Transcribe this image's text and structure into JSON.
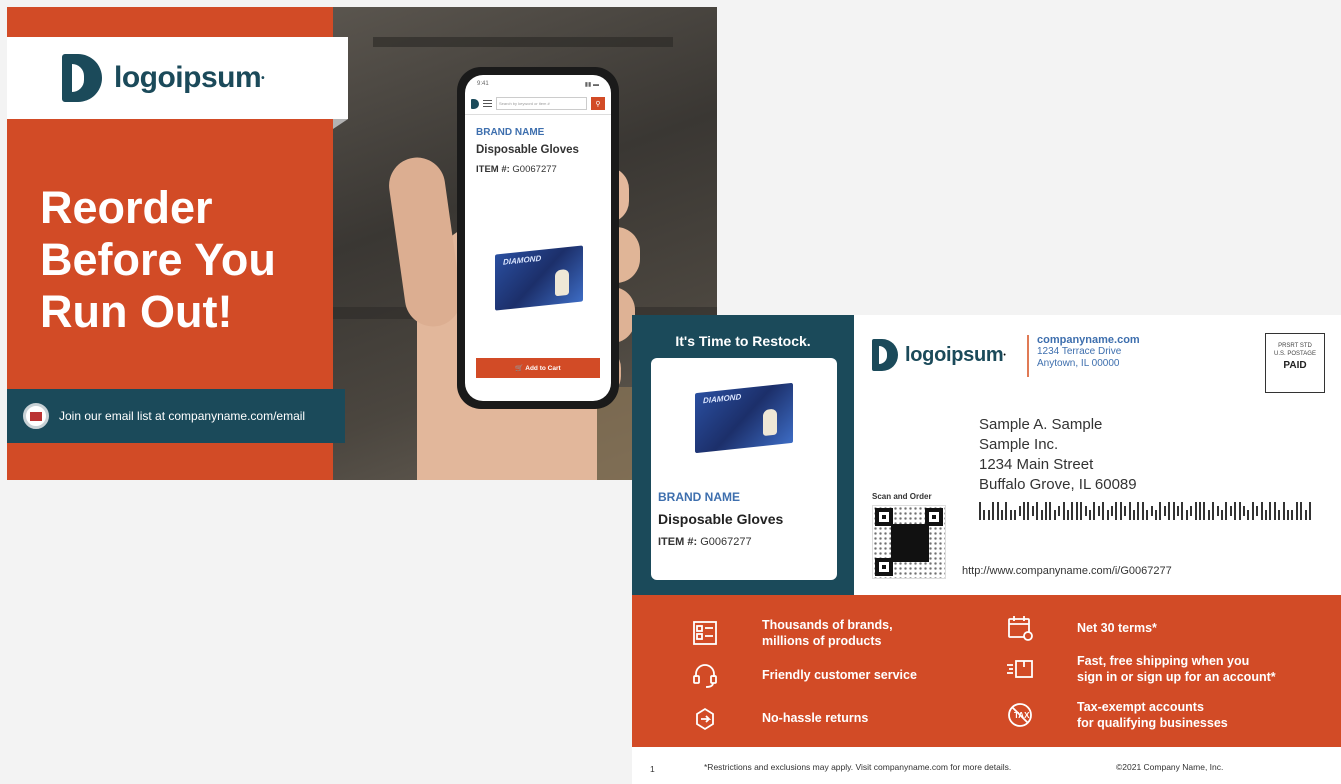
{
  "front": {
    "logo_text": "logoipsum",
    "headline": "Reorder Before You Run Out!",
    "email_bar": "Join our email list at companyname.com/email",
    "phone": {
      "status_time": "9:41",
      "status_icons": "▮▮ ▬",
      "search_placeholder": "Search by keyword or item #",
      "brand": "BRAND NAME",
      "product": "Disposable Gloves",
      "item_label": "ITEM #:",
      "item_number": "G0067277",
      "product_box_text": "DIAMOND",
      "cart_button": "Add to Cart"
    }
  },
  "back": {
    "restock_heading": "It's Time to Restock.",
    "brand": "BRAND NAME",
    "product": "Disposable Gloves",
    "item_label": "ITEM #:",
    "item_number": "G0067277",
    "product_box_text": "DIAMOND",
    "logo_text": "logoipsum",
    "company": {
      "url": "companyname.com",
      "street": "1234 Terrace Drive",
      "city": "Anytown, IL 00000"
    },
    "postage": {
      "line1": "PRSRT STD",
      "line2": "U.S. POSTAGE",
      "paid": "PAID"
    },
    "address": {
      "name": "Sample A. Sample",
      "company": "Sample Inc.",
      "street": "1234 Main Street",
      "city": "Buffalo Grove, IL  60089"
    },
    "scan_label": "Scan and Order",
    "reorder_link": "http://www.companyname.com/i/G0067277",
    "benefits": [
      {
        "icon": "catalog-icon",
        "text": "Thousands of brands,\nmillions of products"
      },
      {
        "icon": "headset-icon",
        "text": "Friendly customer service"
      },
      {
        "icon": "return-box-icon",
        "text": "No-hassle returns"
      },
      {
        "icon": "calendar-icon",
        "text": "Net 30 terms*"
      },
      {
        "icon": "shipping-box-icon",
        "text": "Fast, free shipping when you\nsign in or sign up for an account*"
      },
      {
        "icon": "no-tax-icon",
        "text": "Tax-exempt accounts\nfor qualifying businesses"
      }
    ],
    "footer": {
      "page": "1",
      "disclaimer": "*Restrictions and exclusions may apply. Visit companyname.com for more details.",
      "copyright": "©2021 Company Name, Inc."
    }
  },
  "colors": {
    "orange": "#d24b26",
    "navy": "#1b4a5a",
    "brand_blue": "#3e6fae",
    "background": "#f3f3f3"
  }
}
